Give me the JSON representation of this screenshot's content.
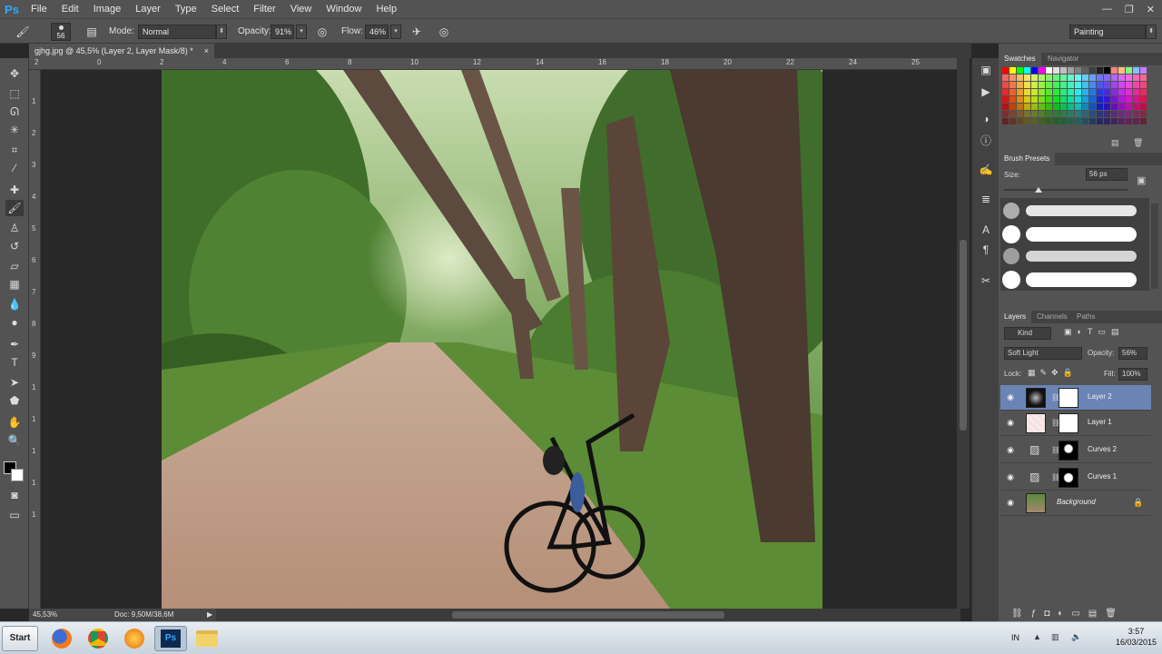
{
  "menubar": {
    "logo": "Ps",
    "items": [
      "File",
      "Edit",
      "Image",
      "Layer",
      "Type",
      "Select",
      "Filter",
      "View",
      "Window",
      "Help"
    ]
  },
  "options": {
    "brush_size": "56",
    "mode_label": "Mode:",
    "mode_value": "Normal",
    "opacity_label": "Opacity:",
    "opacity_value": "91%",
    "flow_label": "Flow:",
    "flow_value": "46%",
    "workspace": "Painting"
  },
  "document": {
    "tab_title": "gjhg.jpg @ 45,5% (Layer 2, Layer Mask/8) *",
    "close": "×"
  },
  "rulers": {
    "top": [
      "2",
      "0",
      "2",
      "4",
      "6",
      "8",
      "10",
      "12",
      "14",
      "16",
      "18",
      "20",
      "22",
      "24",
      "25"
    ],
    "left": [
      "1",
      "2",
      "3",
      "4",
      "5",
      "6",
      "7",
      "8",
      "9",
      "1",
      "1",
      "1",
      "1",
      "1"
    ]
  },
  "status": {
    "zoom": "45,53%",
    "doc": "Doc: 9,50M/38,6M"
  },
  "swatches": {
    "tabs": [
      "Swatches",
      "Navigator"
    ]
  },
  "brush_presets": {
    "tab": "Brush Presets",
    "size_label": "Size:",
    "size_value": "56 px"
  },
  "layers_panel": {
    "tabs": [
      "Layers",
      "Channels",
      "Paths"
    ],
    "filter_kind": "Kind",
    "blend_mode": "Soft Light",
    "opacity_label": "Opacity:",
    "opacity_value": "56%",
    "lock_label": "Lock:",
    "fill_label": "Fill:",
    "fill_value": "100%",
    "layers": [
      {
        "name": "Layer 2"
      },
      {
        "name": "Layer 1"
      },
      {
        "name": "Curves 2"
      },
      {
        "name": "Curves 1"
      },
      {
        "name": "Background"
      }
    ]
  },
  "taskbar": {
    "start_label": "Start",
    "lang": "IN",
    "time": "3:57",
    "date": "16/03/2015",
    "apps": [
      "firefox-icon",
      "chrome-icon",
      "browser-icon",
      "photoshop-icon",
      "folder-icon"
    ]
  }
}
